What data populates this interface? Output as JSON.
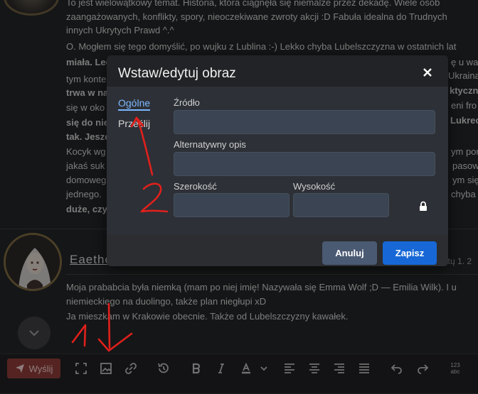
{
  "post1": {
    "lines": [
      "To jest wielowątkowy temat. Historia, która ciągnęła się niemalże przez dekadę. Wiele osób",
      "zaangażowanych, konflikty, spory, nieoczekiwane zwroty akcji :D Fabuła idealna do Trudnych",
      "innych Ukrytych Prawd ^.^",
      "O. Mogłem się tego domyślić, po wujku z Lublina :-) Lekko chyba Lubelszczyzna w ostatnich lat",
      "miała. Lec",
      "tym konte",
      "trwa w na",
      "się w oko",
      "się do nie",
      "tak. Jeszo",
      "Kocyk wg",
      "jakaś suk",
      "domoweg",
      "jednego.",
      "duże, czy"
    ],
    "right_fragments": [
      "ę u was",
      "Ukraina",
      "ktyczne",
      "eni fro",
      "Lukrec",
      "ym por",
      "pasow",
      "ym się",
      "chyba"
    ]
  },
  "post2": {
    "username": "Eaetho",
    "date": "utų 1. 2",
    "lines": [
      "Moja prababcia była niemką (mam po niej imię! Nazywała się Emma Wolf ;D — Emilia Wilk). I u",
      "niemieckiego na duolingo, także plan niegłupi xD",
      "Ja mieszkam w Krakowie obecnie. Także od Lubelszczyzny kawałek."
    ]
  },
  "toolbar": {
    "send_label": "Wyślij",
    "icons": [
      "fullscreen-icon",
      "image-icon",
      "link-icon",
      "history-icon",
      "bold-icon",
      "italic-icon",
      "text-color-icon",
      "chevron-down-icon",
      "align-left-icon",
      "align-center-icon",
      "align-right-icon",
      "align-justify-icon",
      "undo-icon",
      "redo-icon",
      "word-count-icon"
    ],
    "word_count_top": "123",
    "word_count_bottom": "abc"
  },
  "dialog": {
    "title": "Wstaw/edytuj obraz",
    "tabs": [
      "Ogólne",
      "Prześlij"
    ],
    "active_tab": "Ogólne",
    "source_label": "Źródło",
    "source_value": "",
    "alt_label": "Alternatywny opis",
    "alt_value": "",
    "width_label": "Szerokość",
    "width_value": "",
    "height_label": "Wysokość",
    "height_value": "",
    "cancel_label": "Anuluj",
    "save_label": "Zapisz"
  },
  "colors": {
    "page_bg": "#232426",
    "dialog_bg": "#2b2d30",
    "accent_blue": "#1768d6",
    "cancel_bg": "#4b5a73",
    "send_bg": "#8a3a38",
    "annotation_red": "#e0201c"
  }
}
